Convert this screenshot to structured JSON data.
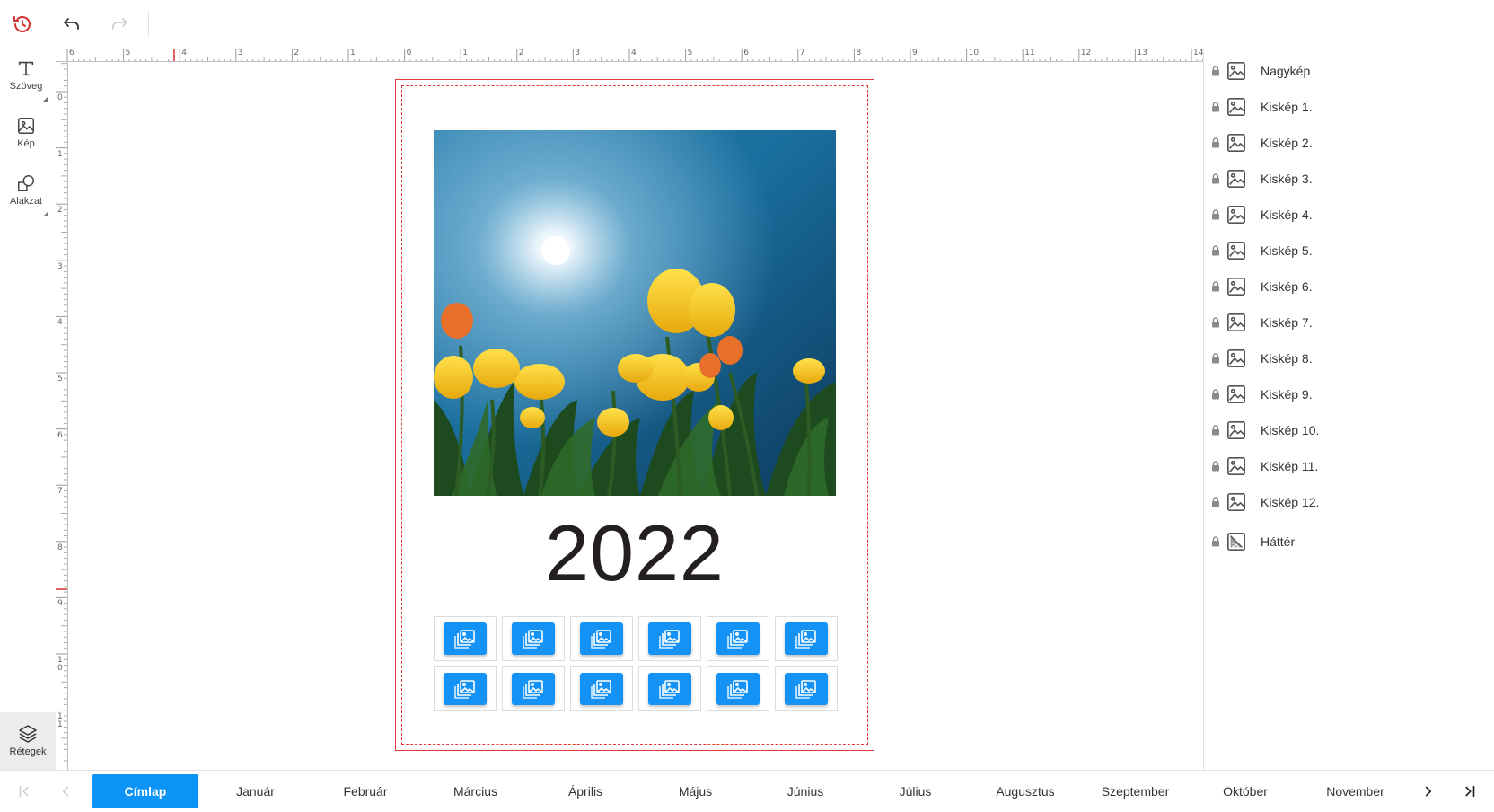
{
  "toolbar": {
    "history_icon": "history-icon",
    "undo_icon": "undo-icon",
    "redo_icon": "redo-icon",
    "history_color": "#d32f2f"
  },
  "tools": [
    {
      "label": "Szöveg",
      "icon": "text-icon"
    },
    {
      "label": "Kép",
      "icon": "image-icon"
    },
    {
      "label": "Alakzat",
      "icon": "shape-icon"
    }
  ],
  "layers_tool": {
    "label": "Rétegek",
    "icon": "layers-icon"
  },
  "ruler": {
    "horizontal": [
      "6",
      "5",
      "4",
      "3",
      "2",
      "1",
      "0",
      "1",
      "2",
      "3",
      "4",
      "5",
      "6",
      "7",
      "8",
      "9",
      "10",
      "11",
      "12",
      "13",
      "14"
    ],
    "vertical": [
      "0",
      "1",
      "2",
      "3",
      "4",
      "5",
      "6",
      "7",
      "8",
      "9",
      "10",
      "11"
    ]
  },
  "page": {
    "year": "2022",
    "placeholder_count": 12
  },
  "layers": [
    {
      "name": "Nagykép",
      "icon": "image-icon",
      "locked": true
    },
    {
      "name": "Kiskép 1.",
      "icon": "image-icon",
      "locked": true
    },
    {
      "name": "Kiskép 2.",
      "icon": "image-icon",
      "locked": true
    },
    {
      "name": "Kiskép 3.",
      "icon": "image-icon",
      "locked": true
    },
    {
      "name": "Kiskép 4.",
      "icon": "image-icon",
      "locked": true
    },
    {
      "name": "Kiskép 5.",
      "icon": "image-icon",
      "locked": true
    },
    {
      "name": "Kiskép 6.",
      "icon": "image-icon",
      "locked": true
    },
    {
      "name": "Kiskép 7.",
      "icon": "image-icon",
      "locked": true
    },
    {
      "name": "Kiskép 8.",
      "icon": "image-icon",
      "locked": true
    },
    {
      "name": "Kiskép 9.",
      "icon": "image-icon",
      "locked": true
    },
    {
      "name": "Kiskép 10.",
      "icon": "image-icon",
      "locked": true
    },
    {
      "name": "Kiskép 11.",
      "icon": "image-icon",
      "locked": true
    },
    {
      "name": "Kiskép 12.",
      "icon": "image-icon",
      "locked": true
    },
    {
      "name": "Háttér",
      "icon": "background-icon",
      "locked": true
    }
  ],
  "pages": {
    "active": "Címlap",
    "tabs": [
      "Címlap",
      "Január",
      "Február",
      "Március",
      "Április",
      "Május",
      "Június",
      "Július",
      "Augusztus",
      "Szeptember",
      "Október",
      "November"
    ],
    "first_icon": "first-page-icon",
    "prev_icon": "prev-page-icon",
    "next_icon": "next-page-icon",
    "last_icon": "last-page-icon"
  },
  "colors": {
    "accent": "#0b93f6",
    "placeholder": "#1492f5",
    "bleed": "#e53935"
  }
}
